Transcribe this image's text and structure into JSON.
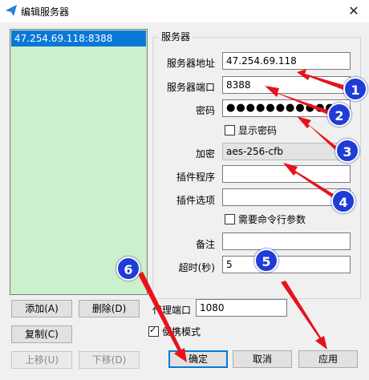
{
  "window": {
    "title": "编辑服务器",
    "close_glyph": "✕"
  },
  "server_list": {
    "items": [
      "47.254.69.118:8388"
    ]
  },
  "buttons": {
    "add": "添加(A)",
    "delete": "删除(D)",
    "copy": "复制(C)",
    "move_up": "上移(U)",
    "move_down": "下移(D)",
    "ok": "确定",
    "cancel": "取消",
    "apply": "应用"
  },
  "server_group": {
    "title": "服务器",
    "address_label": "服务器地址",
    "address_value": "47.254.69.118",
    "port_label": "服务器端口",
    "port_value": "8388",
    "password_label": "密码",
    "password_value": "●●●●●●●●●●●",
    "show_password_label": "显示密码",
    "encryption_label": "加密",
    "encryption_value": "aes-256-cfb",
    "plugin_label": "插件程序",
    "plugin_value": "",
    "plugin_options_label": "插件选项",
    "plugin_options_value": "",
    "need_cmd_args_label": "需要命令行参数",
    "remark_label": "备注",
    "remark_value": "",
    "timeout_label": "超时(秒)",
    "timeout_value": "5"
  },
  "proxy_port": {
    "label": "代理端口",
    "value": "1080"
  },
  "portable_mode": {
    "label": "便携模式",
    "checked": true
  },
  "annotations": {
    "color": "#1f3dd6",
    "arrow_color": "#e8121b",
    "numbers": [
      "1",
      "2",
      "3",
      "4",
      "5",
      "6"
    ]
  }
}
